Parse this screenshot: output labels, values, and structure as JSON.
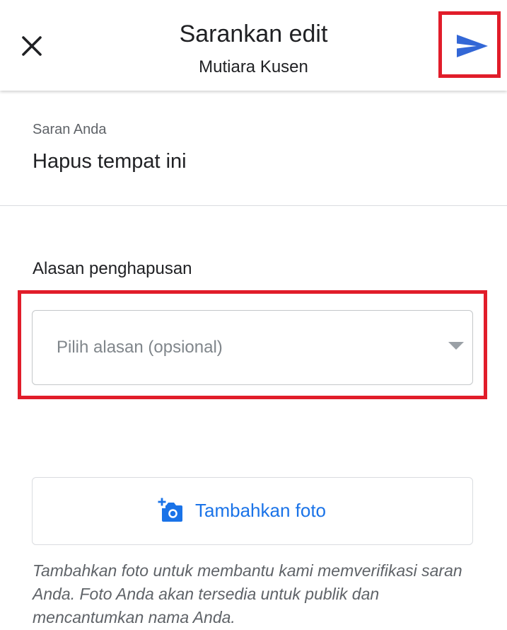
{
  "header": {
    "title": "Sarankan edit",
    "subtitle": "Mutiara Kusen",
    "close_icon": "close-icon",
    "send_icon": "send-icon"
  },
  "suggestion": {
    "label": "Saran Anda",
    "value": "Hapus tempat ini"
  },
  "reason": {
    "label": "Alasan penghapusan",
    "placeholder": "Pilih alasan (opsional)",
    "dropdown_icon": "dropdown-arrow-icon"
  },
  "photo": {
    "button_label": "Tambahkan foto",
    "icon": "add-a-photo-icon",
    "helper_text": "Tambahkan foto untuk membantu kami memverifikasi saran Anda. Foto Anda akan tersedia untuk publik dan mencantumkan nama Anda."
  },
  "colors": {
    "accent": "#1a73e8",
    "send_icon": "#3367d6",
    "highlight": "#e11d2a",
    "text_primary": "#202124",
    "text_secondary": "#5f6368"
  }
}
